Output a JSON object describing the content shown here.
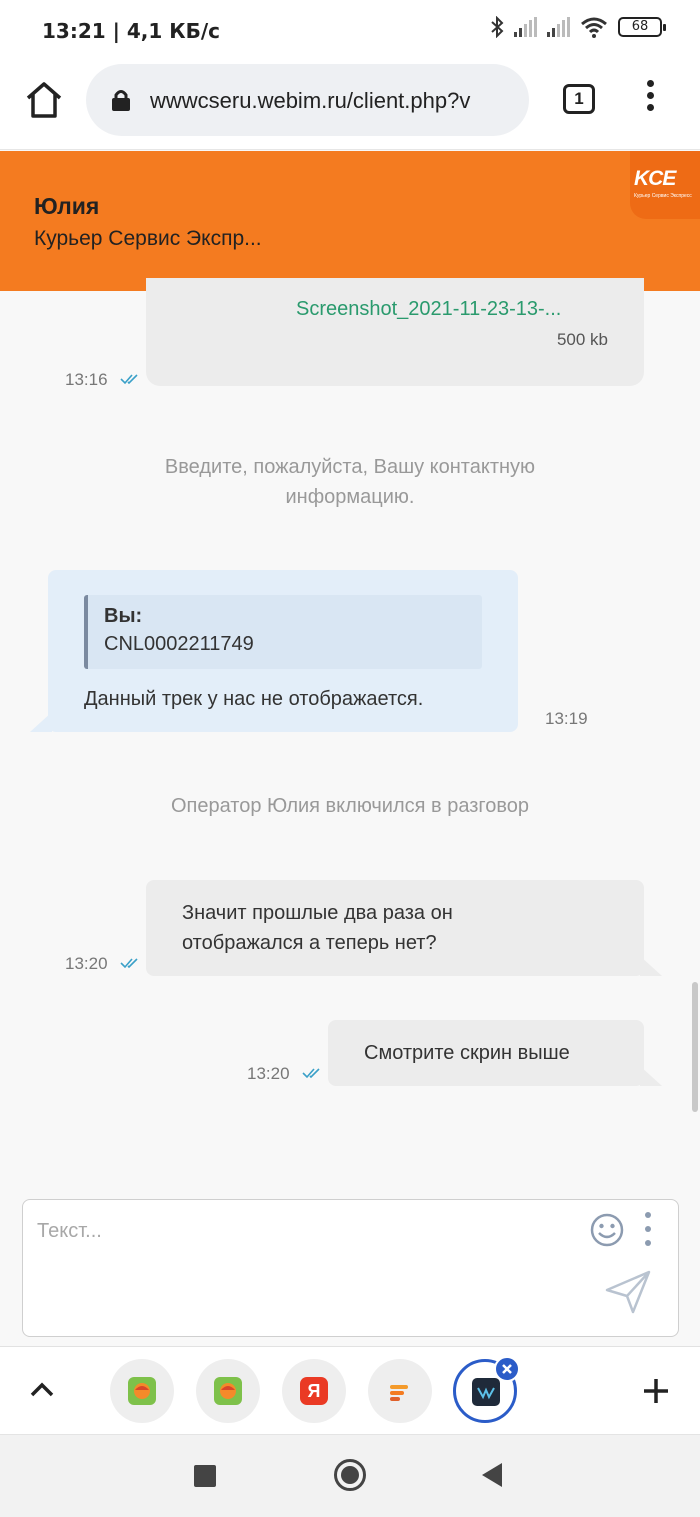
{
  "status_bar": {
    "time": "13:21 | 4,1 КБ/с",
    "battery": "68"
  },
  "browser": {
    "url": "wwwcseru.webim.ru/client.php?v",
    "tab_count": "1"
  },
  "header": {
    "operator_name": "Юлия",
    "company": "Курьер Сервис Экспр...",
    "logo_text": "KCE",
    "logo_subtitle": "Курьер Сервис Экспресс"
  },
  "messages": {
    "file": {
      "name": "Screenshot_2021-11-23-13-...",
      "size": "500 kb",
      "time": "13:16"
    },
    "system_1": "Введите, пожалуйста, Вашу контактную информацию.",
    "operator_reply": {
      "quote_author": "Вы:",
      "quote_text": "CNL0002211749",
      "text": "Данный трек у нас не отображается.",
      "time": "13:19"
    },
    "system_2": "Оператор Юлия включился в разговор",
    "user_msg_1": {
      "text": "Значит прошлые два раза он отображался а теперь нет?",
      "time": "13:20"
    },
    "user_msg_2": {
      "text": "Смотрите скрин выше",
      "time": "13:20"
    }
  },
  "input": {
    "placeholder": "Текст..."
  },
  "tab_strip": {
    "tabs": [
      "app-tab-1",
      "app-tab-2",
      "yandex-tab",
      "app-tab-4",
      "webim-tab"
    ],
    "yandex_letter": "Я"
  },
  "colors": {
    "accent": "#f47b20",
    "file_link": "#2a9a6d",
    "incoming_bubble": "#e3eef9",
    "outgoing_bubble": "#ececec"
  }
}
